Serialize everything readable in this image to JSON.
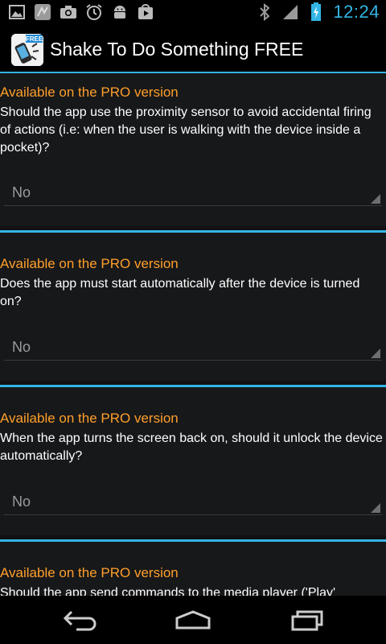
{
  "status_bar": {
    "time": "12:24",
    "left_icons": [
      "gallery-icon",
      "app-notification-icon",
      "camera-icon",
      "alarm-icon",
      "android-icon",
      "play-store-icon"
    ],
    "right_icons": [
      "bluetooth-icon",
      "signal-icon",
      "battery-charging-icon"
    ]
  },
  "action_bar": {
    "title": "Shake To Do Something FREE",
    "icon_badge": "FREE"
  },
  "preferences": [
    {
      "pro_label": "Available on the PRO version",
      "description": "Should the app use the proximity sensor to avoid accidental firing of actions (i.e: when the user is walking with the device inside a pocket)?",
      "value": "No"
    },
    {
      "pro_label": "Available on the PRO version",
      "description": "Does the app must start automatically after the device is turned on?",
      "value": "No"
    },
    {
      "pro_label": "Available on the PRO version",
      "description": "When the app turns the screen back on, should it unlock the device automatically?",
      "value": "No"
    },
    {
      "pro_label": "Available on the PRO version",
      "description": "Should the app send commands to the media player ('Play'",
      "value": ""
    }
  ],
  "nav_bar": {
    "buttons": [
      "back-icon",
      "home-icon",
      "recent-apps-icon"
    ]
  },
  "colors": {
    "accent": "#33b5e5",
    "pro_label": "#ff9f2a",
    "background": "#17181a"
  }
}
